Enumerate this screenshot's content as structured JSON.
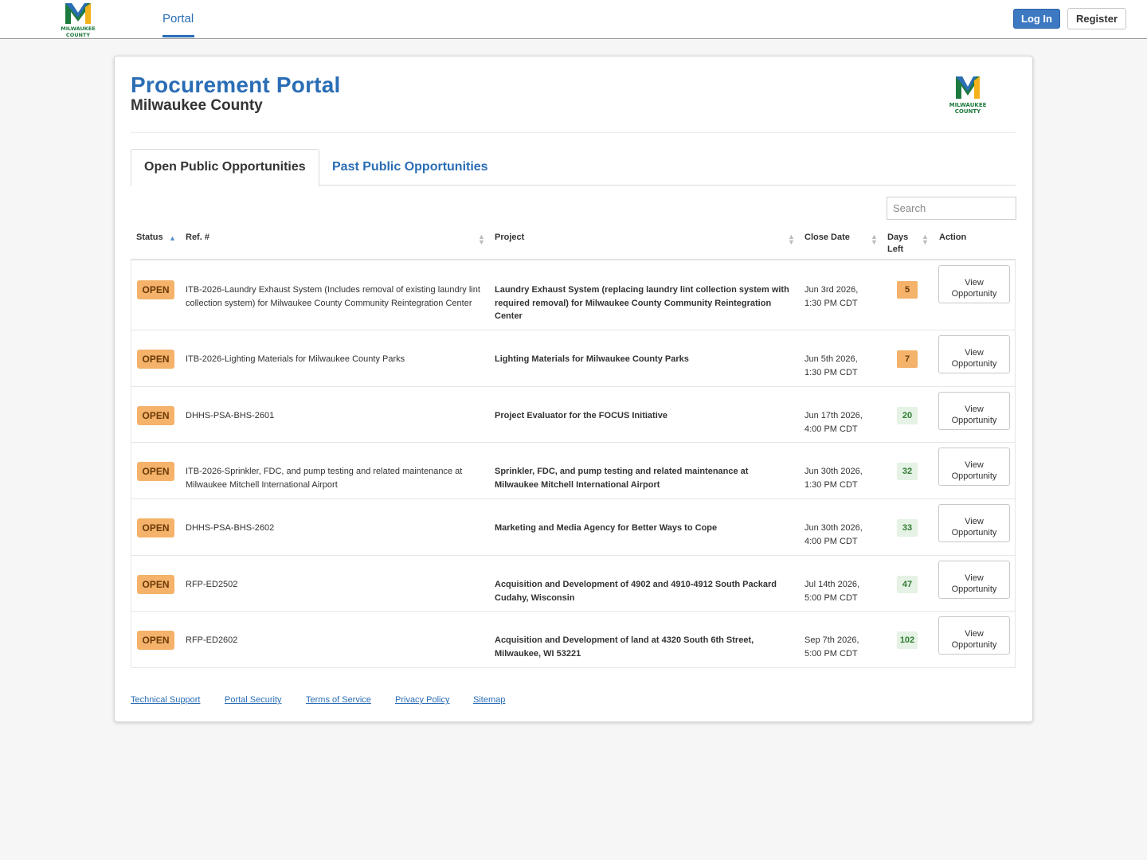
{
  "brand": {
    "logo_text_line1": "MILWAUKEE",
    "logo_text_line2": "COUNTY",
    "colors": {
      "green": "#1d7a3e",
      "gold": "#f2b21b",
      "blue": "#2a6db5"
    }
  },
  "topnav": {
    "portal_label": "Portal",
    "login_label": "Log In",
    "register_label": "Register"
  },
  "header": {
    "title": "Procurement Portal",
    "subtitle": "Milwaukee County"
  },
  "tabs": [
    {
      "label": "Open Public Opportunities",
      "active": true
    },
    {
      "label": "Past Public Opportunities",
      "active": false
    }
  ],
  "search": {
    "placeholder": "Search"
  },
  "table": {
    "columns": [
      "Status",
      "Ref. #",
      "Project",
      "Close Date",
      "Days Left",
      "Action"
    ],
    "rows": [
      {
        "status": "OPEN",
        "ref": "ITB-2026-Laundry Exhaust System (Includes removal of existing laundry lint collection system) for Milwaukee County Community Reintegration Center",
        "project": "Laundry Exhaust System (replacing laundry lint collection system with required removal) for Milwaukee County Community Reintegration Center",
        "close_date": "Jun 3rd 2026, 1:30 PM CDT",
        "days_left": "5",
        "urgent": true,
        "action": "View Opportunity"
      },
      {
        "status": "OPEN",
        "ref": "ITB-2026-Lighting Materials for Milwaukee County Parks",
        "project": "Lighting Materials for Milwaukee County Parks",
        "close_date": "Jun 5th 2026, 1:30 PM CDT",
        "days_left": "7",
        "urgent": true,
        "action": "View Opportunity"
      },
      {
        "status": "OPEN",
        "ref": "DHHS-PSA-BHS-2601",
        "project": "Project Evaluator for the FOCUS Initiative",
        "close_date": "Jun 17th 2026, 4:00 PM CDT",
        "days_left": "20",
        "urgent": false,
        "action": "View Opportunity"
      },
      {
        "status": "OPEN",
        "ref": "ITB-2026-Sprinkler, FDC, and pump testing and related maintenance at Milwaukee Mitchell International Airport",
        "project": "Sprinkler, FDC, and pump testing and related maintenance at Milwaukee Mitchell International Airport",
        "close_date": "Jun 30th 2026, 1:30 PM CDT",
        "days_left": "32",
        "urgent": false,
        "action": "View Opportunity"
      },
      {
        "status": "OPEN",
        "ref": "DHHS-PSA-BHS-2602",
        "project": "Marketing and Media Agency for Better Ways to Cope",
        "close_date": "Jun 30th 2026, 4:00 PM CDT",
        "days_left": "33",
        "urgent": false,
        "action": "View Opportunity"
      },
      {
        "status": "OPEN",
        "ref": "RFP-ED2502",
        "project": "Acquisition and Development of 4902 and 4910-4912 South Packard Cudahy, Wisconsin",
        "close_date": "Jul 14th 2026, 5:00 PM CDT",
        "days_left": "47",
        "urgent": false,
        "action": "View Opportunity"
      },
      {
        "status": "OPEN",
        "ref": "RFP-ED2602",
        "project": "Acquisition and Development of land at 4320 South 6th Street, Milwaukee, WI 53221",
        "close_date": "Sep 7th 2026, 5:00 PM CDT",
        "days_left": "102",
        "urgent": false,
        "action": "View Opportunity"
      }
    ]
  },
  "footer": {
    "links": [
      "Technical Support",
      "Portal Security",
      "Terms of Service",
      "Privacy Policy",
      "Sitemap"
    ]
  }
}
